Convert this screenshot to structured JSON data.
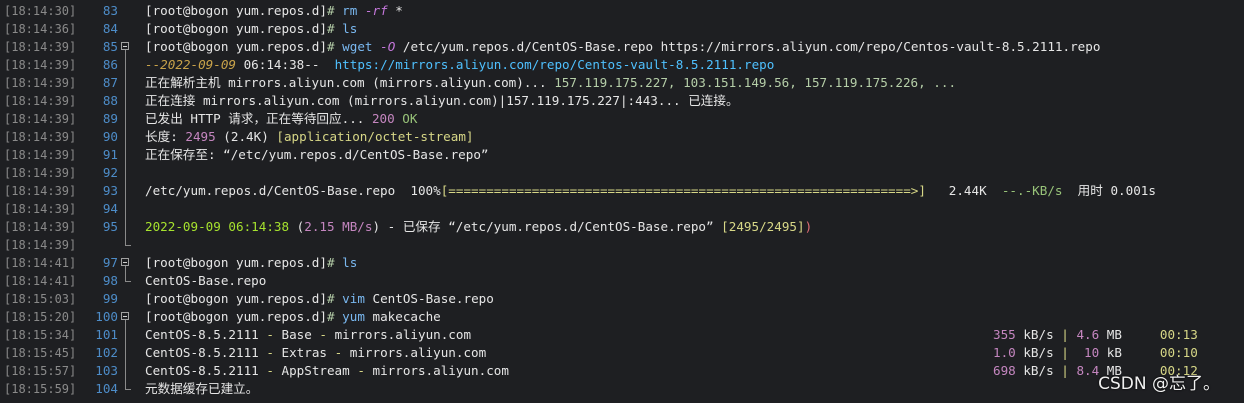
{
  "colors": {
    "background": "#1e1f22",
    "timestamp": "#8a8a8a",
    "line_number": "#4d8cc8",
    "command": "#7ab8f0",
    "url": "#4fc1ff",
    "number": "#b5cea8"
  },
  "rows": [
    {
      "ts": "[18:14:30]",
      "ln": "83"
    },
    {
      "ts": "[18:14:36]",
      "ln": "84"
    },
    {
      "ts": "[18:14:39]",
      "ln": "85"
    },
    {
      "ts": "[18:14:39]",
      "ln": "86"
    },
    {
      "ts": "[18:14:39]",
      "ln": "87"
    },
    {
      "ts": "[18:14:39]",
      "ln": "88"
    },
    {
      "ts": "[18:14:39]",
      "ln": "89"
    },
    {
      "ts": "[18:14:39]",
      "ln": "90"
    },
    {
      "ts": "[18:14:39]",
      "ln": "91"
    },
    {
      "ts": "[18:14:39]",
      "ln": "92"
    },
    {
      "ts": "[18:14:39]",
      "ln": "93"
    },
    {
      "ts": "[18:14:39]",
      "ln": "94"
    },
    {
      "ts": "[18:14:39]",
      "ln": "95"
    },
    {
      "ts": "[18:14:39]",
      "ln": ""
    },
    {
      "ts": "[18:14:41]",
      "ln": "97"
    },
    {
      "ts": "[18:14:41]",
      "ln": "98"
    },
    {
      "ts": "[18:15:03]",
      "ln": "99"
    },
    {
      "ts": "[18:15:20]",
      "ln": "100"
    },
    {
      "ts": "[18:15:34]",
      "ln": "101"
    },
    {
      "ts": "[18:15:45]",
      "ln": "102"
    },
    {
      "ts": "[18:15:57]",
      "ln": "103"
    },
    {
      "ts": "[18:15:59]",
      "ln": "104"
    }
  ],
  "prompt": "[root@bogon yum.repos.d]",
  "hash": "#",
  "line83": {
    "cmd": "rm",
    "flag": "-rf",
    "arg": "*"
  },
  "line84": {
    "cmd": "ls"
  },
  "line85": {
    "cmd": "wget",
    "flag": "-O",
    "arg": "/etc/yum.repos.d/CentOS-Base.repo https://mirrors.aliyun.com/repo/Centos-vault-8.5.2111.repo"
  },
  "line86": {
    "dashes_a": "--",
    "date": "2022-09-09",
    "time": " 06:14:38--",
    "url": "  https://mirrors.aliyun.com/repo/Centos-vault-8.5.2111.repo"
  },
  "line87": {
    "text_a": "正在解析主机 mirrors.aliyun.com (mirrors.aliyun.com)... ",
    "ips": "157.119.175.227, 103.151.149.56, 157.119.175.226, ..."
  },
  "line88": {
    "text": "正在连接 mirrors.aliyun.com (mirrors.aliyun.com)|157.119.175.227|:443... 已连接。"
  },
  "line89": {
    "text": "已发出 HTTP 请求，正在等待回应... ",
    "code": "200",
    "status": " OK"
  },
  "line90": {
    "label": "长度: ",
    "size": "2495",
    "human": " (2.4K) ",
    "type": "[application/octet-stream]"
  },
  "line91": {
    "text": "正在保存至: “/etc/yum.repos.d/CentOS-Base.repo”"
  },
  "line93": {
    "file": "/etc/yum.repos.d/CentOS-Base.repo  ",
    "pct": "100%",
    "bar": "[=============================================================>]",
    "size": "2.44K",
    "rate": "--.-KB/s",
    "elapsed": "用时 0.001s"
  },
  "line95": {
    "date": "2022-09-09 06:14:38",
    "rate_open": " (",
    "rate": "2.15 MB/s",
    "rate_close": ")",
    "text": " - 已保存 “/etc/yum.repos.d/CentOS-Base.repo” ",
    "count": "[2495/2495]",
    "end_paren": ")"
  },
  "line97": {
    "cmd": "ls"
  },
  "line98": {
    "text": "CentOS-Base.repo"
  },
  "line99": {
    "cmd": "vim",
    "arg": "CentOS-Base.repo"
  },
  "line100": {
    "cmd": "yum",
    "arg": "makecache"
  },
  "repos": [
    {
      "name": "CentOS-8.5.2111",
      "dash": " - ",
      "repo": "Base",
      "mirror": "mirrors.aliyun.com",
      "speed": "355",
      "unit": " kB/s",
      "size": "4.6",
      "size_unit": " MB",
      "time": "00:13"
    },
    {
      "name": "CentOS-8.5.2111",
      "dash": " - ",
      "repo": "Extras",
      "mirror": "mirrors.aliyun.com",
      "speed": "1.0",
      "unit": " kB/s",
      "size": " 10",
      "size_unit": " kB",
      "time": "00:10"
    },
    {
      "name": "CentOS-8.5.2111",
      "dash": " - ",
      "repo": "AppStream",
      "mirror": "mirrors.aliyun.com",
      "speed": "698",
      "unit": " kB/s",
      "size": "8.4",
      "size_unit": " MB",
      "time": "00:12"
    }
  ],
  "line104": {
    "text": "元数据缓存已建立。"
  },
  "watermark": "CSDN @忘了。"
}
